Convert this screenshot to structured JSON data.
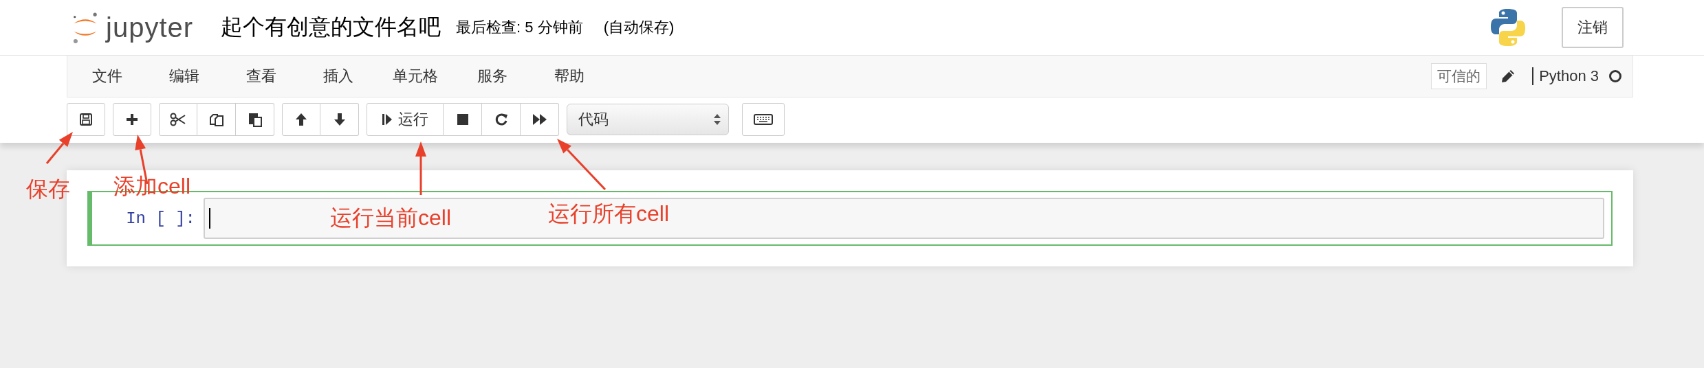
{
  "header": {
    "logo_text": "jupyter",
    "notebook_title": "起个有创意的文件名吧",
    "checkpoint": "最后检查: 5 分钟前",
    "autosave": "(自动保存)",
    "logout_button": "注销"
  },
  "menu": [
    {
      "label": "文件"
    },
    {
      "label": "编辑"
    },
    {
      "label": "查看"
    },
    {
      "label": "插入"
    },
    {
      "label": "单元格"
    },
    {
      "label": "服务"
    },
    {
      "label": "帮助"
    }
  ],
  "trusted_badge": "可信的",
  "kernel": {
    "name": "Python 3",
    "busy": false
  },
  "toolbar": {
    "run_label": "运行",
    "cell_type": "代码"
  },
  "cell": {
    "prompt": "In [ ]:",
    "editing": true
  },
  "annotations": [
    {
      "text": "保存"
    },
    {
      "text": "添加cell"
    },
    {
      "text": "运行当前cell"
    },
    {
      "text": "运行所有cell"
    }
  ]
}
